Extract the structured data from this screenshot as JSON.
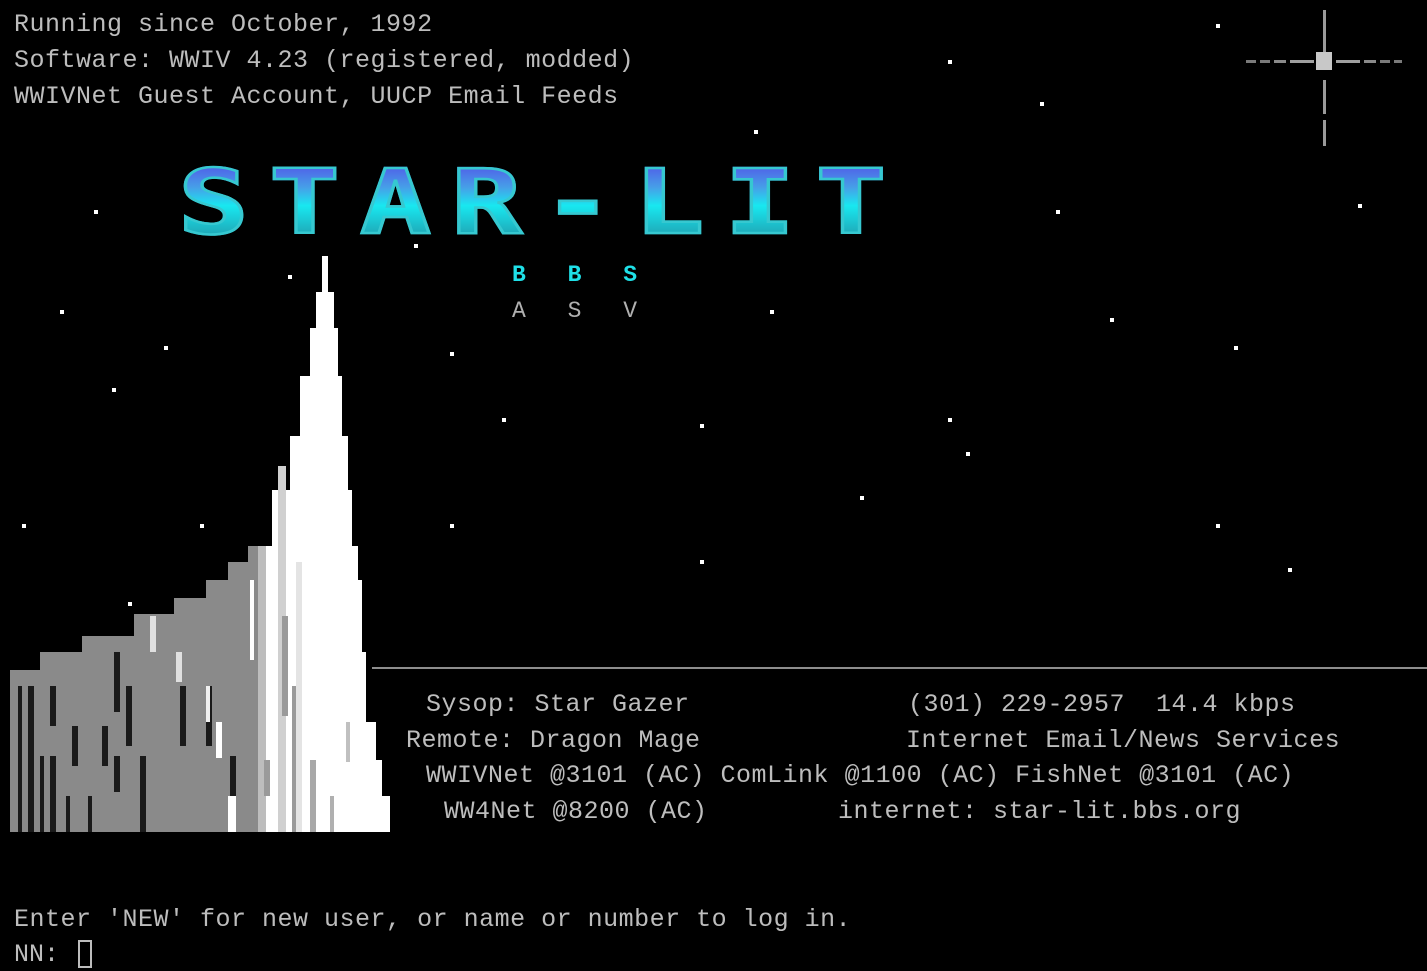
{
  "header": {
    "line1": "Running since October, 1992",
    "line2": "Software: WWIV 4.23 (registered, modded)",
    "line3": "WWIVNet Guest Account, UUCP Email Feeds"
  },
  "logo": {
    "text": "STAR-LIT",
    "subtitle_top": "B B S",
    "subtitle_bottom": "A S V",
    "colors": {
      "logo_top": "#5060e8",
      "logo_mid": "#18e8f0",
      "subtitle_top": "#1fe0e8",
      "subtitle_bottom": "#b0b0b0"
    }
  },
  "info": {
    "sysop": "Sysop: Star Gazer",
    "phone": "(301) 229-2957  14.4 kbps",
    "remote": "Remote: Dragon Mage",
    "services": "Internet Email/News Services",
    "networks": "WWIVNet @3101 (AC) ComLink @1100 (AC) FishNet @3101 (AC)",
    "ww4net": "WW4Net @8200 (AC)",
    "internet": "internet: star-lit.bbs.org"
  },
  "prompt": {
    "message": "Enter 'NEW' for new user, or name or number to log in.",
    "label": "NN:",
    "value": ""
  },
  "graphics": {
    "stars_icon": "starfield",
    "sparkle_icon": "sparkle-star-icon",
    "mountain_icon": "mountain-peak-icon",
    "background": "#000000",
    "text_color": "#bdbdbd"
  }
}
